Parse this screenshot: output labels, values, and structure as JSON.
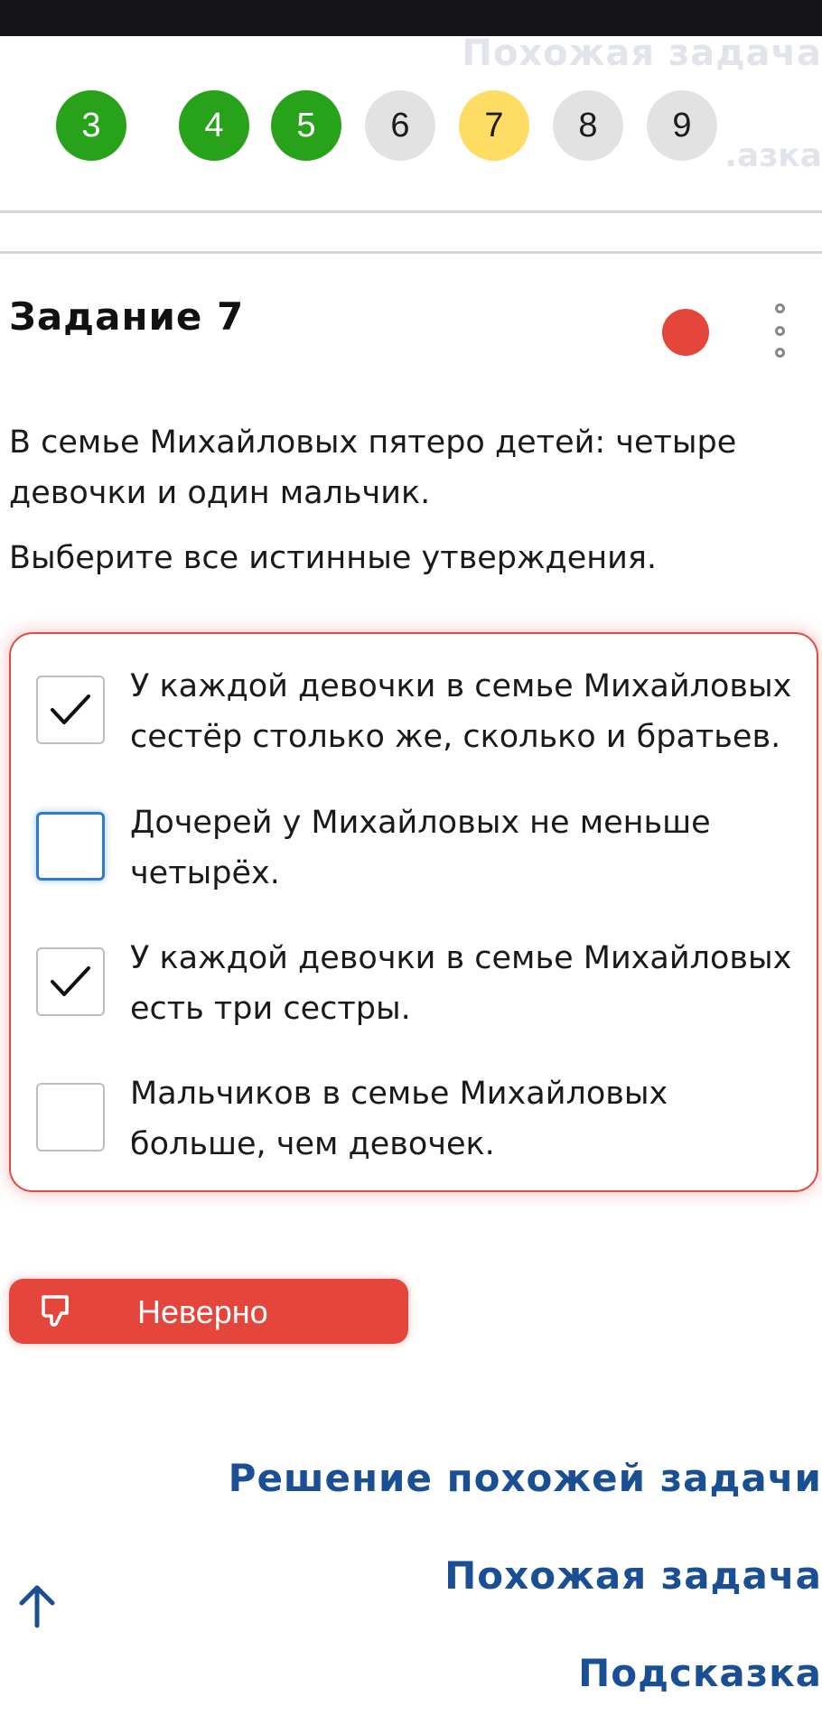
{
  "header": {
    "ghost_similar": "Похожая задача",
    "ghost_hint": ".азка"
  },
  "pager": {
    "items": [
      {
        "label": "3",
        "state": "solved"
      },
      {
        "label": "4",
        "state": "solved"
      },
      {
        "label": "5",
        "state": "solved"
      },
      {
        "label": "6",
        "state": "unsolved"
      },
      {
        "label": "7",
        "state": "current"
      },
      {
        "label": "8",
        "state": "unsolved"
      },
      {
        "label": "9",
        "state": "unsolved"
      }
    ]
  },
  "task": {
    "title": "Задание 7",
    "question": "В семье Михайловых пятеро детей: четыре девочки и один мальчик.",
    "instruction": "Выберите все истинные утверждения."
  },
  "options": [
    {
      "label": "У каждой девочки в семье Михайловых сестёр столько же, сколько и братьев.",
      "checked": true
    },
    {
      "label": "Дочерей у Михайловых не меньше четырёх.",
      "checked": false
    },
    {
      "label": "У каждой девочки в семье Михайловых есть три сестры.",
      "checked": true
    },
    {
      "label": "Мальчиков в семье Михайловых больше, чем девочек.",
      "checked": false
    }
  ],
  "result": {
    "label": "Неверно"
  },
  "links": {
    "solution": "Решение похожей задачи",
    "similar": "Похожая задача",
    "hint": "Подсказка"
  },
  "colors": {
    "solved": "#28a21a",
    "current": "#ffdc63",
    "unsolved": "#e2e2e2",
    "error": "#e4463b",
    "link": "#1b4f93",
    "focus": "#2e7bd6"
  }
}
